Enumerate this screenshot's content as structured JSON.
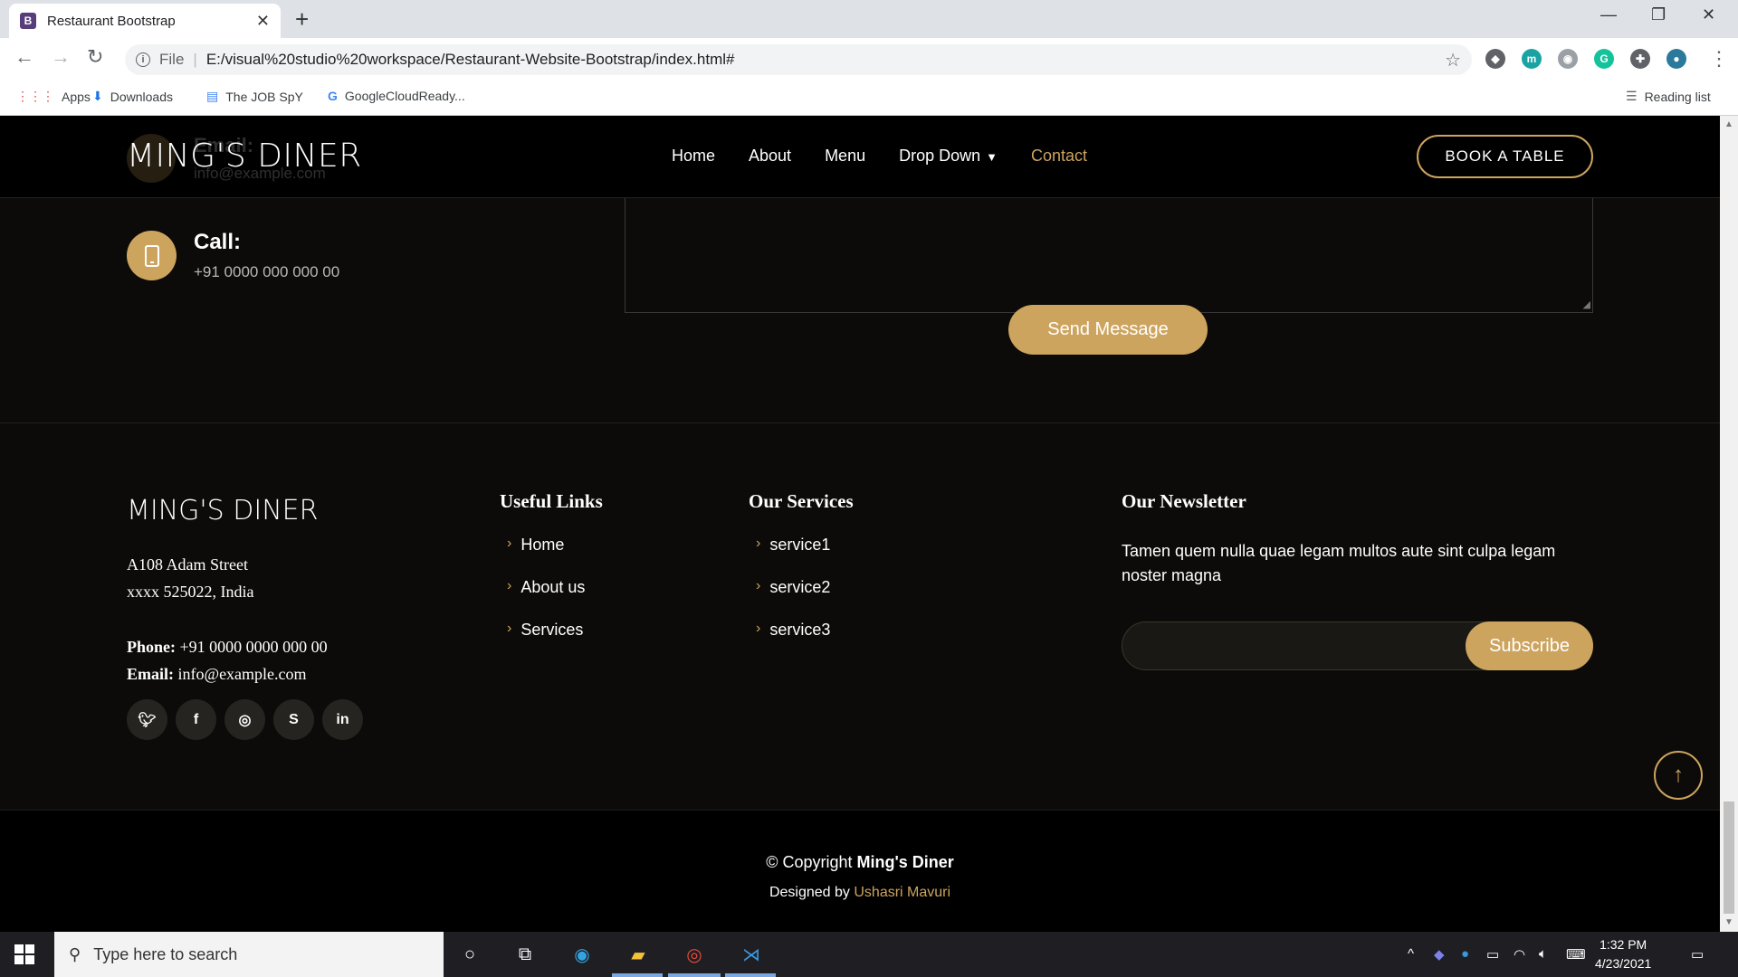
{
  "browser": {
    "tab_title": "Restaurant Bootstrap",
    "tab_favicon": "B",
    "address_scheme": "File",
    "address_url": "E:/visual%20studio%20workspace/Restaurant-Website-Bootstrap/index.html#",
    "bookmarks": [
      "Apps",
      "Downloads",
      "The JOB SpY",
      "GoogleCloudReady..."
    ],
    "reading_list": "Reading list"
  },
  "header": {
    "logo": "MING'S DINER",
    "ghost_title": "Email:",
    "ghost_value": "info@example.com",
    "nav": [
      "Home",
      "About",
      "Menu",
      "Drop Down",
      "Contact"
    ],
    "active_nav": "Contact",
    "book_button": "BOOK A TABLE"
  },
  "contact": {
    "call_title": "Call:",
    "call_value": "+91 0000 000 000 00",
    "send_button": "Send Message"
  },
  "footer": {
    "logo": "MING'S DINER",
    "address_line1": "A108 Adam Street",
    "address_line2": "xxxx 525022, India",
    "phone_label": "Phone:",
    "phone_value": "+91 0000 0000 000 00",
    "email_label": "Email:",
    "email_value": "info@example.com",
    "useful_links_title": "Useful Links",
    "useful_links": [
      "Home",
      "About us",
      "Services"
    ],
    "services_title": "Our Services",
    "services": [
      "service1",
      "service2",
      "service3"
    ],
    "newsletter_title": "Our Newsletter",
    "newsletter_text": "Tamen quem nulla quae legam multos aute sint culpa legam noster magna",
    "subscribe_button": "Subscribe",
    "copyright_prefix": "© Copyright",
    "copyright_name": "Ming's Diner",
    "designed_by": "Designed by",
    "designer": "Ushasri Mavuri"
  },
  "taskbar": {
    "search_placeholder": "Type here to search",
    "time": "1:32 PM",
    "date": "4/23/2021"
  },
  "colors": {
    "accent": "#cda45e",
    "background": "#0c0b09"
  }
}
